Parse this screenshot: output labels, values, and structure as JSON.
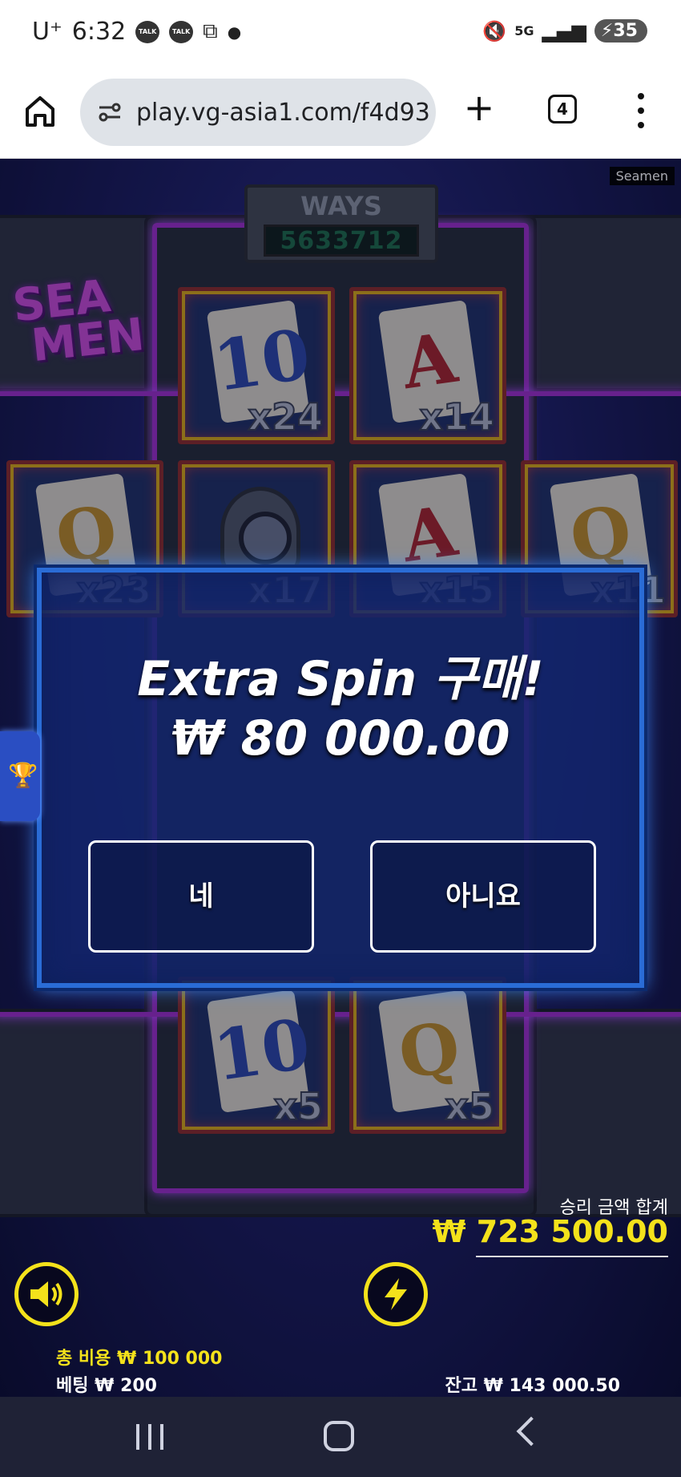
{
  "status_bar": {
    "carrier": "U⁺",
    "time": "6:32",
    "notif_talk_1": "TALK",
    "notif_talk_2": "TALK",
    "network": "5G",
    "battery": "35"
  },
  "browser": {
    "url": "play.vg-asia1.com/f4d93",
    "tab_count": "4"
  },
  "game": {
    "game_id": "Seamen",
    "ways_label": "WAYS",
    "ways_value": "5633712",
    "logo_line1": "SEA",
    "logo_line2": "MEN",
    "reels": [
      {
        "symbol": "10",
        "color": "blue",
        "mult": "x24"
      },
      {
        "symbol": "A",
        "color": "red",
        "mult": "x14"
      },
      {
        "symbol": "Q",
        "color": "gold",
        "mult": "x23"
      },
      {
        "symbol": "helmet",
        "color": "gray",
        "mult": "x17"
      },
      {
        "symbol": "A",
        "color": "red",
        "mult": "x15"
      },
      {
        "symbol": "Q",
        "color": "gold",
        "mult": "x11"
      },
      {
        "symbol": "10",
        "color": "blue",
        "mult": "x5"
      },
      {
        "symbol": "Q",
        "color": "gold",
        "mult": "x5"
      }
    ],
    "modal": {
      "title": "Extra Spin 구매!",
      "price": "₩ 80 000.00",
      "yes_label": "네",
      "no_label": "아니요"
    },
    "hud": {
      "win_label": "승리 금액 합계",
      "win_value": "₩ 723 500.00",
      "cost_label": "총 비용  ₩ 100 000",
      "bet_label": "베팅  ₩ 200",
      "balance_label": "잔고  ₩ 143 000.50"
    },
    "colors": {
      "accent_yellow": "#f4e21b",
      "modal_border": "#2a6cd6",
      "purple_frame": "#9b2fc9"
    }
  }
}
